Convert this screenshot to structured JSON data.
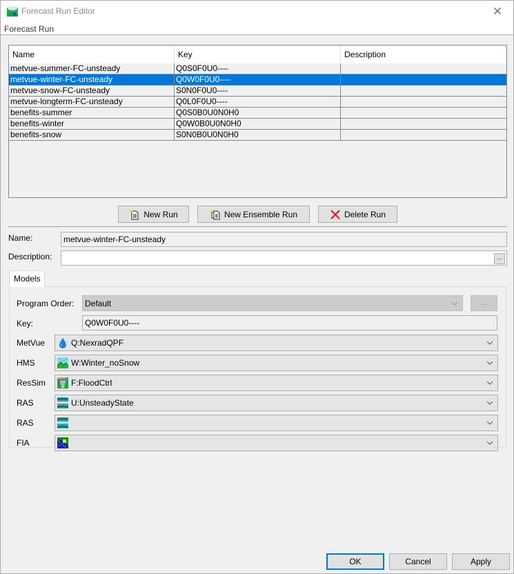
{
  "window": {
    "title": "Forecast Run Editor",
    "close_icon": "close-icon"
  },
  "menu": {
    "items": [
      "Forecast Run"
    ]
  },
  "runs_table": {
    "columns": [
      "Name",
      "Key",
      "Description"
    ],
    "rows": [
      {
        "name": "metvue-summer-FC-unsteady",
        "key": "Q0S0F0U0----",
        "description": "",
        "selected": false
      },
      {
        "name": "metvue-winter-FC-unsteady",
        "key": "Q0W0F0U0----",
        "description": "",
        "selected": true
      },
      {
        "name": "metvue-snow-FC-unsteady",
        "key": "S0N0F0U0----",
        "description": "",
        "selected": false
      },
      {
        "name": "metvue-longterm-FC-unsteady",
        "key": "Q0L0F0U0----",
        "description": "",
        "selected": false
      },
      {
        "name": "benefits-summer",
        "key": "Q0S0B0U0N0H0",
        "description": "",
        "selected": false
      },
      {
        "name": "benefits-winter",
        "key": "Q0W0B0U0N0H0",
        "description": "",
        "selected": false
      },
      {
        "name": "benefits-snow",
        "key": "S0N0B0U0N0H0",
        "description": "",
        "selected": false
      }
    ]
  },
  "actions": {
    "new_run": "New Run",
    "new_ensemble_run": "New Ensemble Run",
    "delete_run": "Delete Run"
  },
  "form": {
    "name_label": "Name:",
    "name_value": "metvue-winter-FC-unsteady",
    "description_label": "Description:",
    "description_value": "",
    "ellipsis": "..."
  },
  "tabs": [
    {
      "label": "Models",
      "active": true
    }
  ],
  "models_tab": {
    "program_order_label": "Program Order:",
    "program_order_value": "Default",
    "program_order_button": "...",
    "key_label": "Key:",
    "key_value": "Q0W0F0U0----",
    "models": [
      {
        "label": "MetVue",
        "value": "Q:NexradQPF",
        "icon": "raindrop-icon"
      },
      {
        "label": "HMS",
        "value": "W:Winter_noSnow",
        "icon": "hms-landscape-icon"
      },
      {
        "label": "ResSim",
        "value": "F:FloodCtrl",
        "icon": "ressim-dam-icon"
      },
      {
        "label": "RAS",
        "value": "U:UnsteadyState",
        "icon": "ras-river-icon"
      },
      {
        "label": "RAS",
        "value": "",
        "icon": "ras-river-icon"
      },
      {
        "label": "FIA",
        "value": "",
        "icon": "fia-map-icon"
      }
    ]
  },
  "footer": {
    "ok": "OK",
    "cancel": "Cancel",
    "apply": "Apply"
  },
  "colors": {
    "selection": "#0078d7",
    "default_button_border": "#0078d7"
  }
}
